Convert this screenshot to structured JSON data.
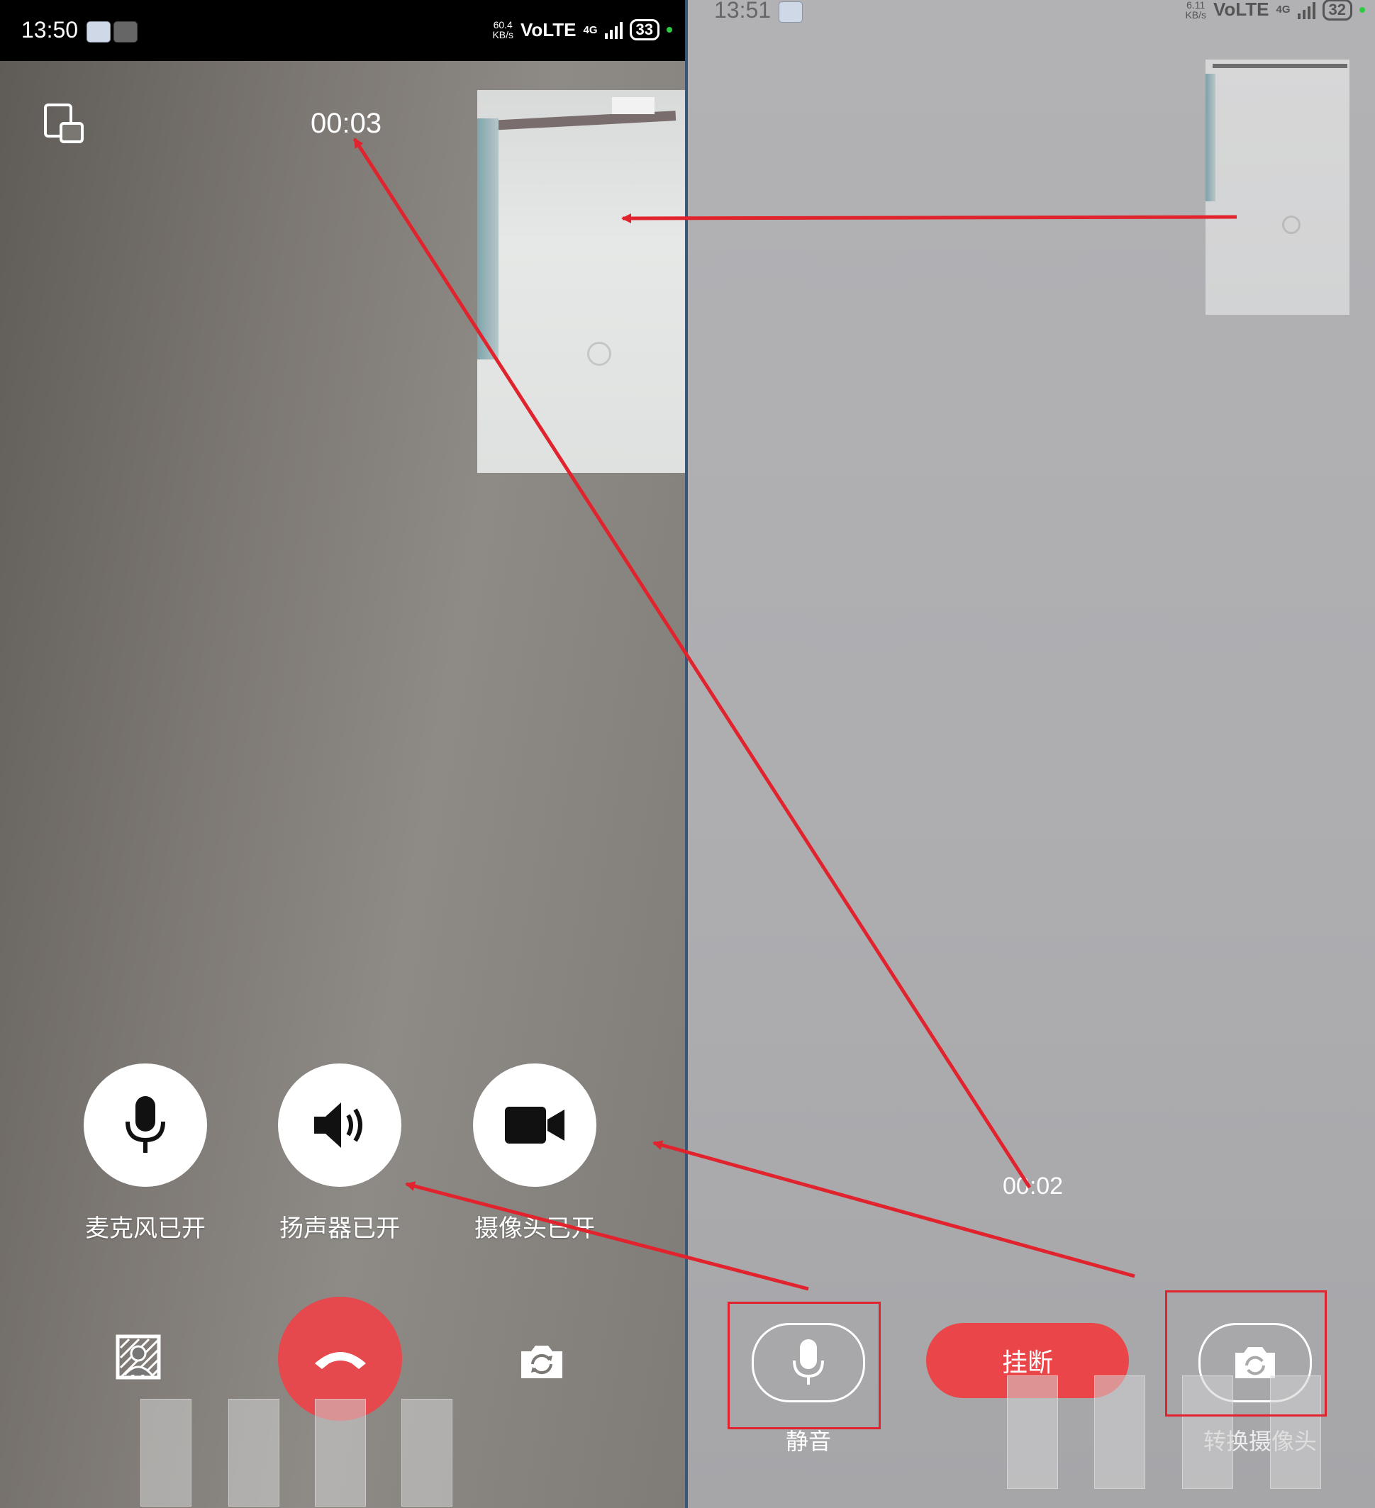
{
  "left_phone": {
    "status_bar": {
      "time": "13:50",
      "speed_value": "60.4",
      "speed_unit": "KB/s",
      "network": "VoLTE",
      "network_type": "4G",
      "battery": "33"
    },
    "call_timer": "00:03",
    "controls": [
      {
        "label": "麦克风已开",
        "icon": "microphone-icon"
      },
      {
        "label": "扬声器已开",
        "icon": "speaker-icon"
      },
      {
        "label": "摄像头已开",
        "icon": "video-camera-icon"
      }
    ],
    "bottom_icons": [
      "portrait-background-icon",
      "hang-up-icon",
      "switch-camera-icon"
    ],
    "colors": {
      "hangup": "#e5484d"
    }
  },
  "right_phone": {
    "status_bar": {
      "time": "13:51",
      "speed_value": "6.11",
      "speed_unit": "KB/s",
      "network": "VoLTE",
      "network_type": "4G",
      "battery": "32"
    },
    "call_timer": "00:02",
    "mute_label": "静音",
    "hangup_label": "挂断",
    "switch_camera_label": "转换摄像头",
    "colors": {
      "hangup": "#ea4649"
    }
  },
  "annotation_color": "#e0232d"
}
